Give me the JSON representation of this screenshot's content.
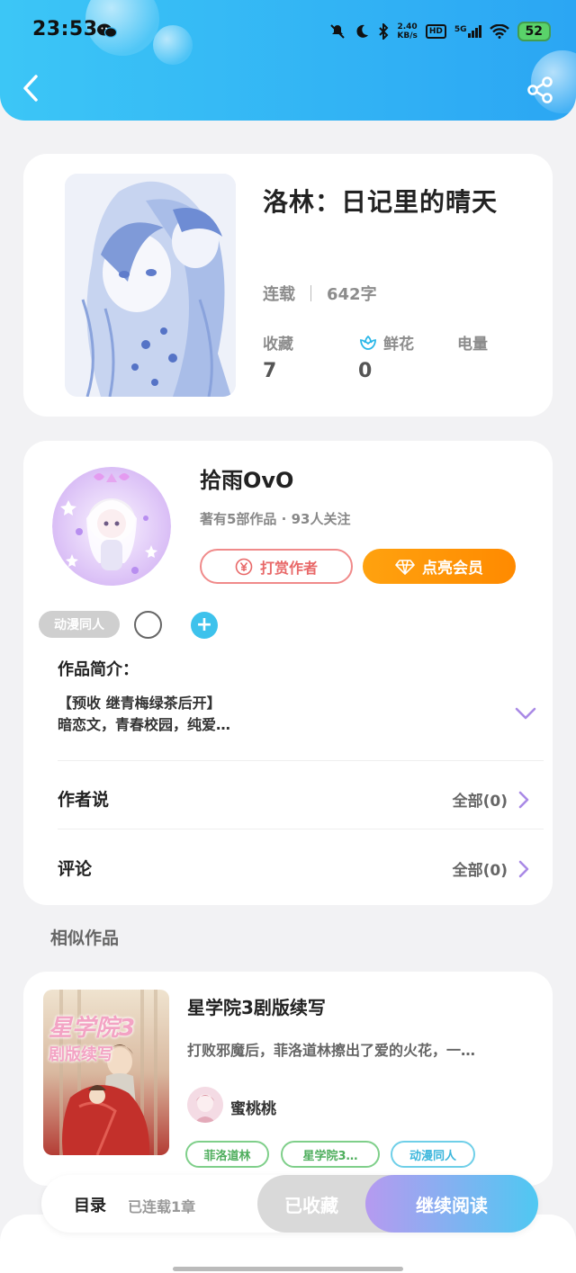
{
  "status_bar": {
    "time": "23:53",
    "net_speed_value": "2.40",
    "net_speed_unit": "KB/s",
    "hd": "HD",
    "signal": "5G",
    "battery": "52"
  },
  "book": {
    "title": "洛林：日记里的晴天",
    "status": "连载",
    "word_count": "642字",
    "stats": [
      {
        "label": "收藏",
        "value": "7"
      },
      {
        "label": "鲜花",
        "value": "0"
      },
      {
        "label": "电量",
        "value": ""
      }
    ]
  },
  "author": {
    "name": "拾雨OvO",
    "sub": "著有5部作品 · 93人关注",
    "tip_button": "打赏作者",
    "vip_button": "点亮会员",
    "tag": "动漫同人",
    "plus": "+"
  },
  "intro": {
    "label": "作品简介：",
    "line1": "【预收 继青梅绿茶后开】",
    "line2": "暗恋文，青春校园，纯爱…"
  },
  "rows": {
    "author_says": {
      "label": "作者说",
      "right": "全部(0)"
    },
    "comments": {
      "label": "评论",
      "right": "全部(0)"
    }
  },
  "similar": {
    "section_title": "相似作品",
    "items": [
      {
        "cover_text1": "星学院3",
        "cover_text2": "剧版续写",
        "title": "星学院3剧版续写",
        "desc": "打败邪魔后，菲洛道林擦出了爱的火花，一…",
        "author": "蜜桃桃",
        "tags": [
          "菲洛道林",
          "星学院3…",
          "动漫同人"
        ]
      }
    ]
  },
  "bottom": {
    "toc": "目录",
    "toc_sub": "已连载1章",
    "collected": "已收藏",
    "read": "继续阅读"
  },
  "colors": {
    "header_start": "#3cc6f6",
    "header_end": "#2ba6f3",
    "vip": "#ff9a0a",
    "tip": "#e86868",
    "accent_purple": "#a98ae6"
  }
}
